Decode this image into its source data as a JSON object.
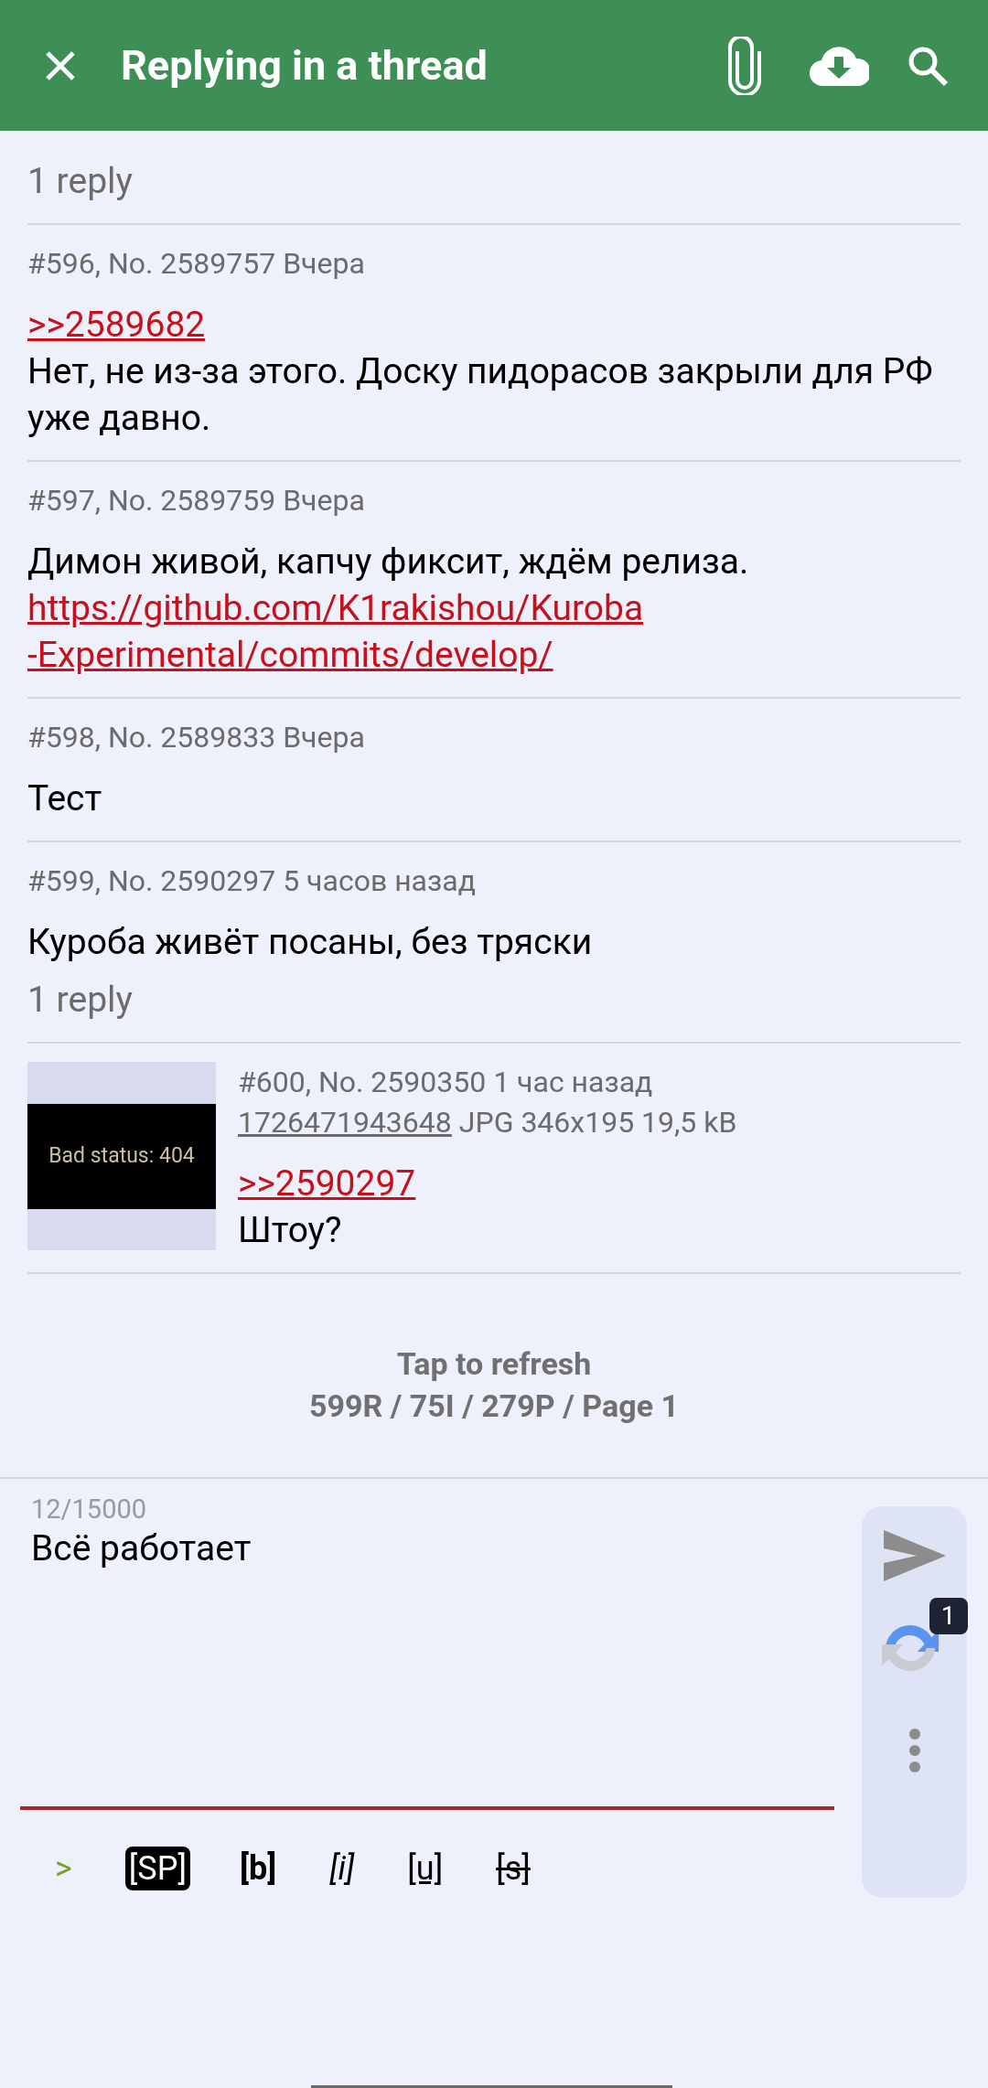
{
  "header": {
    "title": "Replying in a thread"
  },
  "top_replies": "1 reply",
  "posts": [
    {
      "meta": "#596, No. 2589757 Вчера",
      "quote": ">>2589682",
      "body": [
        {
          "kind": "text",
          "text": "Нет, не из-за этого. Доску пидорасов закрыли для РФ уже давно."
        }
      ]
    },
    {
      "meta": "#597, No. 2589759 Вчера",
      "body": [
        {
          "kind": "text",
          "text": "Димон живой, капчу фиксит, ждём релиза."
        },
        {
          "kind": "link",
          "text": "https://github.com/K1rakishou/Kuroba"
        },
        {
          "kind": "link",
          "text": "-Experimental/commits/develop/"
        }
      ]
    },
    {
      "meta": "#598, No. 2589833 Вчера",
      "body": [
        {
          "kind": "text",
          "text": "Тест"
        }
      ]
    },
    {
      "meta": "#599, No. 2590297 5 часов назад",
      "body": [
        {
          "kind": "text",
          "text": "Куроба живёт посаны, без тряски"
        }
      ],
      "replies": "1 reply"
    },
    {
      "meta": "#600, No. 2590350 1 час назад",
      "file": {
        "name": "1726471943648",
        "info": "JPG 346x195 19,5 kB",
        "thumbnail_text": "Bad status: 404"
      },
      "quote": ">>2590297",
      "body": [
        {
          "kind": "text",
          "text": "Штоу?"
        }
      ]
    }
  ],
  "footer": {
    "action": "Tap to refresh",
    "stats": "599R / 75I / 279P / Page 1"
  },
  "reply": {
    "counter": "12/15000",
    "value": "Всё работает",
    "captcha_badge": "1"
  },
  "format_buttons": [
    {
      "label": ">",
      "kind": "quote"
    },
    {
      "label": "[SP]",
      "kind": "spoiler"
    },
    {
      "label": "[b]",
      "kind": "bold"
    },
    {
      "label": "[i]",
      "kind": "italic"
    },
    {
      "label": "[u]",
      "kind": "underline"
    },
    {
      "label": "[s]",
      "kind": "strike"
    }
  ]
}
